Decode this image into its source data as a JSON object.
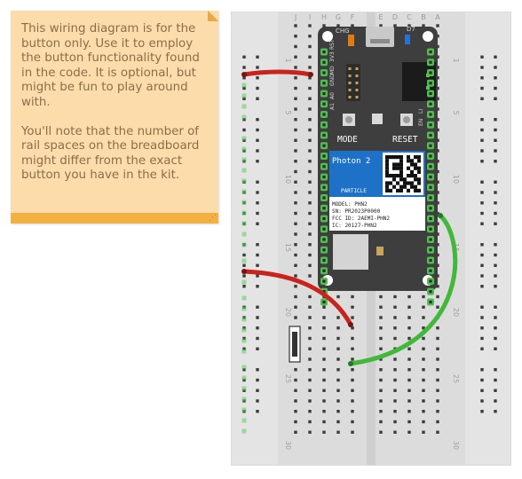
{
  "note": {
    "paragraphs": [
      "This wiring diagram is for the button only.  Use it to employ the button functionality found in the code.  It is optional, but might be fun to play around with.",
      "You'll note that the number of rail spaces on the breadboard might differ from the exact button you have in the kit."
    ]
  },
  "breadboard": {
    "column_letters_left": [
      "J",
      "I",
      "H",
      "G",
      "F"
    ],
    "column_letters_right": [
      "E",
      "D",
      "C",
      "B",
      "A"
    ],
    "row_numbers": [
      "1",
      "5",
      "10",
      "15",
      "20",
      "25",
      "30"
    ]
  },
  "device": {
    "name": "Photon 2",
    "brand": "PARTICLE",
    "led_left": "CHG",
    "led_right": "D7",
    "mode_label": "MODE",
    "reset_label": "RESET",
    "pin_labels_left": [
      "RST",
      "3V3",
      "MD",
      "GND",
      "A0",
      "A1"
    ],
    "pin_labels_right": [
      "LI",
      "EN"
    ],
    "info_lines": [
      "MODEL: PHN2",
      "SN: PR2023P0000",
      "FCC ID: 2AEMI-PHN2",
      "IC: 20127-PHN2"
    ]
  },
  "colors": {
    "wire_red": "#c8231d",
    "wire_green": "#41b83a",
    "board_dark": "#3e3e3e",
    "board_blue": "#1d72c7",
    "hole_green": "#4fbf4f"
  }
}
